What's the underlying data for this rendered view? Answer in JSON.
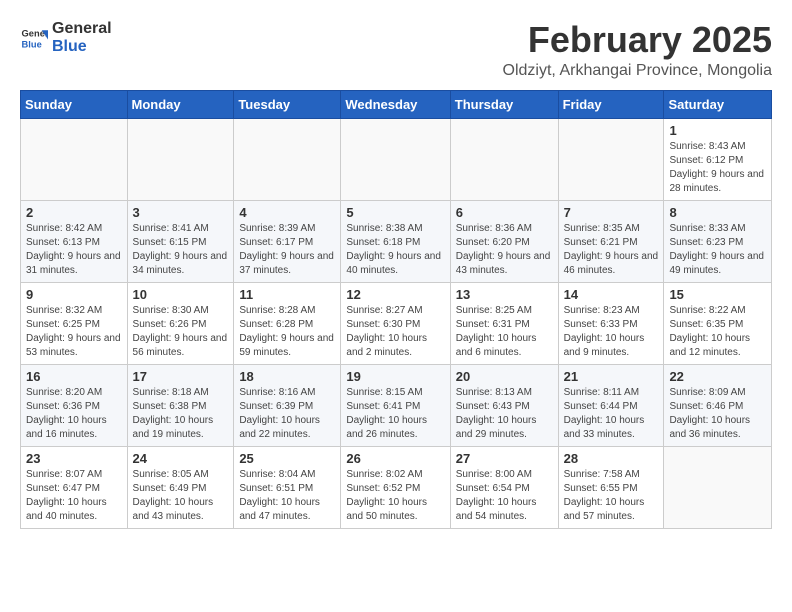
{
  "logo": {
    "general": "General",
    "blue": "Blue"
  },
  "title": "February 2025",
  "subtitle": "Oldziyt, Arkhangai Province, Mongolia",
  "days_of_week": [
    "Sunday",
    "Monday",
    "Tuesday",
    "Wednesday",
    "Thursday",
    "Friday",
    "Saturday"
  ],
  "weeks": [
    [
      {
        "day": "",
        "info": ""
      },
      {
        "day": "",
        "info": ""
      },
      {
        "day": "",
        "info": ""
      },
      {
        "day": "",
        "info": ""
      },
      {
        "day": "",
        "info": ""
      },
      {
        "day": "",
        "info": ""
      },
      {
        "day": "1",
        "info": "Sunrise: 8:43 AM\nSunset: 6:12 PM\nDaylight: 9 hours and 28 minutes."
      }
    ],
    [
      {
        "day": "2",
        "info": "Sunrise: 8:42 AM\nSunset: 6:13 PM\nDaylight: 9 hours and 31 minutes."
      },
      {
        "day": "3",
        "info": "Sunrise: 8:41 AM\nSunset: 6:15 PM\nDaylight: 9 hours and 34 minutes."
      },
      {
        "day": "4",
        "info": "Sunrise: 8:39 AM\nSunset: 6:17 PM\nDaylight: 9 hours and 37 minutes."
      },
      {
        "day": "5",
        "info": "Sunrise: 8:38 AM\nSunset: 6:18 PM\nDaylight: 9 hours and 40 minutes."
      },
      {
        "day": "6",
        "info": "Sunrise: 8:36 AM\nSunset: 6:20 PM\nDaylight: 9 hours and 43 minutes."
      },
      {
        "day": "7",
        "info": "Sunrise: 8:35 AM\nSunset: 6:21 PM\nDaylight: 9 hours and 46 minutes."
      },
      {
        "day": "8",
        "info": "Sunrise: 8:33 AM\nSunset: 6:23 PM\nDaylight: 9 hours and 49 minutes."
      }
    ],
    [
      {
        "day": "9",
        "info": "Sunrise: 8:32 AM\nSunset: 6:25 PM\nDaylight: 9 hours and 53 minutes."
      },
      {
        "day": "10",
        "info": "Sunrise: 8:30 AM\nSunset: 6:26 PM\nDaylight: 9 hours and 56 minutes."
      },
      {
        "day": "11",
        "info": "Sunrise: 8:28 AM\nSunset: 6:28 PM\nDaylight: 9 hours and 59 minutes."
      },
      {
        "day": "12",
        "info": "Sunrise: 8:27 AM\nSunset: 6:30 PM\nDaylight: 10 hours and 2 minutes."
      },
      {
        "day": "13",
        "info": "Sunrise: 8:25 AM\nSunset: 6:31 PM\nDaylight: 10 hours and 6 minutes."
      },
      {
        "day": "14",
        "info": "Sunrise: 8:23 AM\nSunset: 6:33 PM\nDaylight: 10 hours and 9 minutes."
      },
      {
        "day": "15",
        "info": "Sunrise: 8:22 AM\nSunset: 6:35 PM\nDaylight: 10 hours and 12 minutes."
      }
    ],
    [
      {
        "day": "16",
        "info": "Sunrise: 8:20 AM\nSunset: 6:36 PM\nDaylight: 10 hours and 16 minutes."
      },
      {
        "day": "17",
        "info": "Sunrise: 8:18 AM\nSunset: 6:38 PM\nDaylight: 10 hours and 19 minutes."
      },
      {
        "day": "18",
        "info": "Sunrise: 8:16 AM\nSunset: 6:39 PM\nDaylight: 10 hours and 22 minutes."
      },
      {
        "day": "19",
        "info": "Sunrise: 8:15 AM\nSunset: 6:41 PM\nDaylight: 10 hours and 26 minutes."
      },
      {
        "day": "20",
        "info": "Sunrise: 8:13 AM\nSunset: 6:43 PM\nDaylight: 10 hours and 29 minutes."
      },
      {
        "day": "21",
        "info": "Sunrise: 8:11 AM\nSunset: 6:44 PM\nDaylight: 10 hours and 33 minutes."
      },
      {
        "day": "22",
        "info": "Sunrise: 8:09 AM\nSunset: 6:46 PM\nDaylight: 10 hours and 36 minutes."
      }
    ],
    [
      {
        "day": "23",
        "info": "Sunrise: 8:07 AM\nSunset: 6:47 PM\nDaylight: 10 hours and 40 minutes."
      },
      {
        "day": "24",
        "info": "Sunrise: 8:05 AM\nSunset: 6:49 PM\nDaylight: 10 hours and 43 minutes."
      },
      {
        "day": "25",
        "info": "Sunrise: 8:04 AM\nSunset: 6:51 PM\nDaylight: 10 hours and 47 minutes."
      },
      {
        "day": "26",
        "info": "Sunrise: 8:02 AM\nSunset: 6:52 PM\nDaylight: 10 hours and 50 minutes."
      },
      {
        "day": "27",
        "info": "Sunrise: 8:00 AM\nSunset: 6:54 PM\nDaylight: 10 hours and 54 minutes."
      },
      {
        "day": "28",
        "info": "Sunrise: 7:58 AM\nSunset: 6:55 PM\nDaylight: 10 hours and 57 minutes."
      },
      {
        "day": "",
        "info": ""
      }
    ]
  ]
}
